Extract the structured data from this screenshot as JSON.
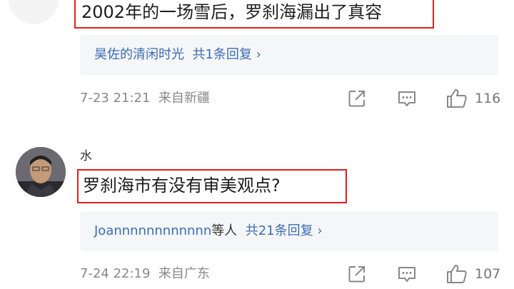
{
  "comments": [
    {
      "text": "2002年的一场雪后，罗刹海漏出了真容",
      "reply_name": "昊佐的清闲时光",
      "reply_others": "",
      "reply_count": "共1条回复",
      "reply_chevron": "›",
      "time": "7-23 21:21",
      "location": "来自新疆",
      "likes": "116"
    },
    {
      "username": "水",
      "text": "罗刹海市有没有审美观点?",
      "reply_name": "Joannnnnnnnnnnn",
      "reply_others": "等人",
      "reply_count": "共21条回复",
      "reply_chevron": "›",
      "time": "7-24 22:19",
      "location": "来自广东",
      "likes": "107"
    }
  ],
  "icons": [
    "share-icon",
    "comment-icon",
    "thumbs-up-icon"
  ],
  "colors": {
    "highlight": "#e0201c",
    "link": "#3c6db2",
    "panel": "#f5f6f8"
  }
}
